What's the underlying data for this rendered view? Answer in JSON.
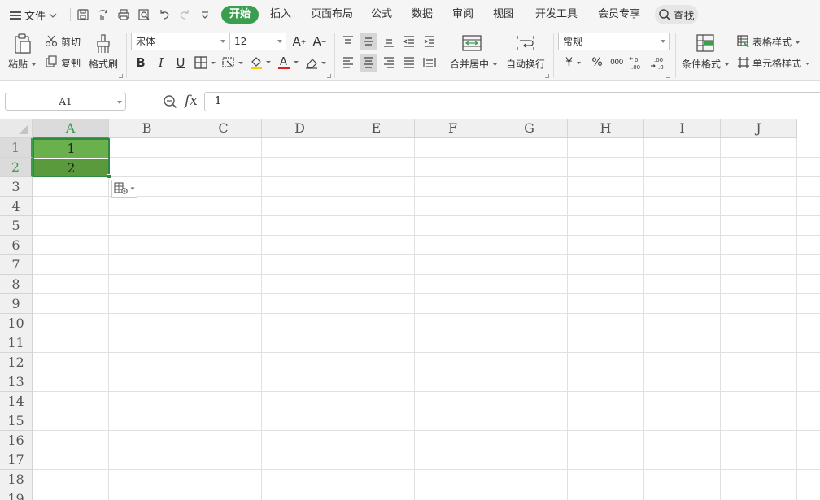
{
  "menu": {
    "file_label": "文件",
    "tabs": [
      {
        "label": "开始",
        "active": true
      },
      {
        "label": "插入"
      },
      {
        "label": "页面布局"
      },
      {
        "label": "公式"
      },
      {
        "label": "数据"
      },
      {
        "label": "审阅"
      },
      {
        "label": "视图"
      },
      {
        "label": "开发工具"
      },
      {
        "label": "会员专享"
      }
    ],
    "search_label": "查找"
  },
  "ribbon": {
    "paste": "粘贴",
    "cut": "剪切",
    "copy": "复制",
    "format_painter": "格式刷",
    "font_name": "宋体",
    "font_size": "12",
    "bold": "B",
    "italic": "I",
    "underline": "U",
    "merge_center": "合并居中",
    "wrap_text": "自动换行",
    "number_format": "常规",
    "currency": "¥",
    "percent": "%",
    "thousands": "000",
    "conditional_format": "条件格式",
    "table_style": "表格样式",
    "cell_style": "单元格样式"
  },
  "formula_bar": {
    "name_box": "A1",
    "fx": "fx",
    "value": "1"
  },
  "grid": {
    "columns": [
      "A",
      "B",
      "C",
      "D",
      "E",
      "F",
      "G",
      "H",
      "I",
      "J"
    ],
    "rows": [
      "1",
      "2",
      "3",
      "4",
      "5",
      "6",
      "7",
      "8",
      "9",
      "10",
      "11",
      "12",
      "13",
      "14",
      "15",
      "16",
      "17",
      "18",
      "19"
    ],
    "cells": {
      "A1": "1",
      "A2": "2"
    },
    "selection": "A1:A2"
  },
  "colors": {
    "accent": "#3a9e4f",
    "selected_cell_a1": "#6ab04c",
    "selected_cell_a2": "#5a9a3c"
  }
}
